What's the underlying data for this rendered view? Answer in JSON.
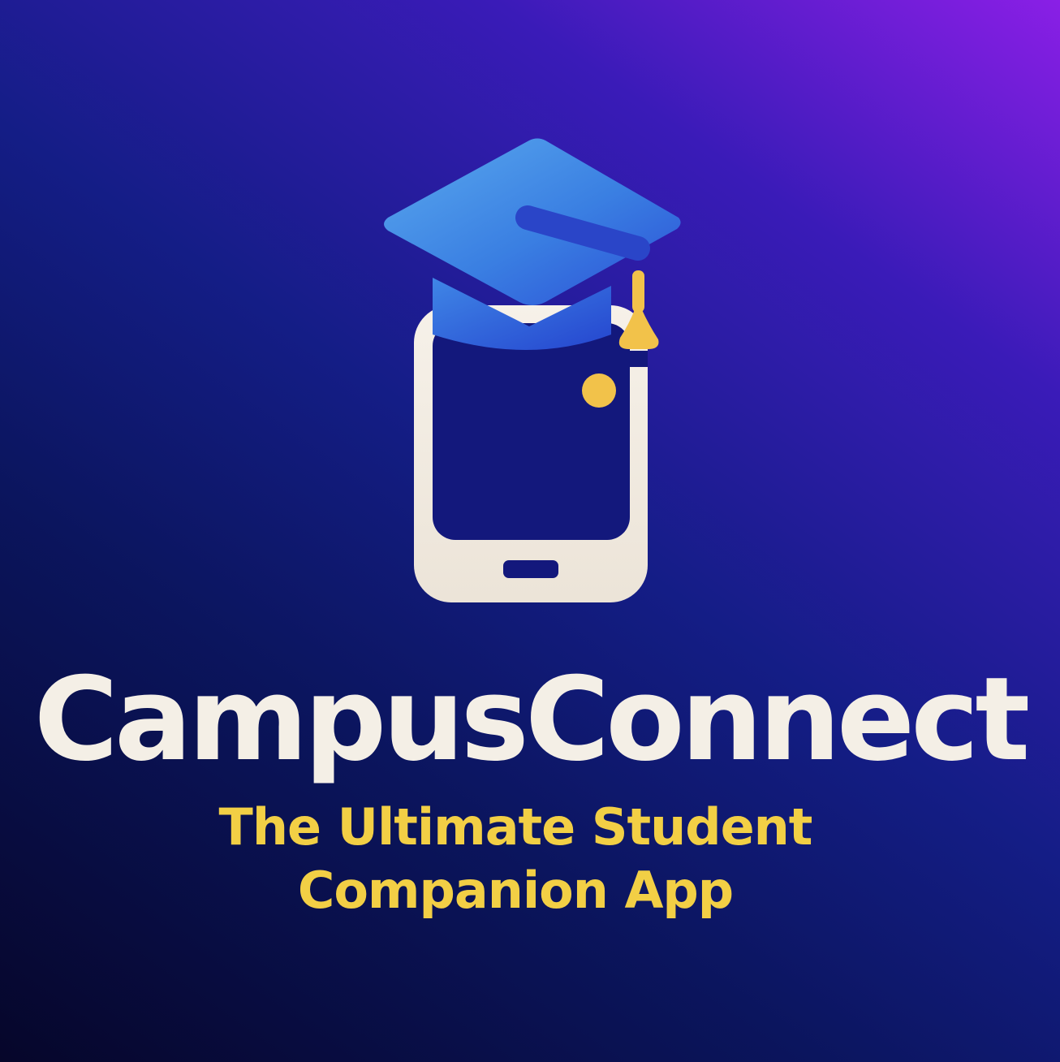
{
  "brand": {
    "name": "CampusConnect",
    "tagline_line1": "The Ultimate Student",
    "tagline_line2": "Companion App"
  },
  "logo": {
    "icons": [
      "phone-icon",
      "graduation-cap-icon",
      "tassel-icon"
    ]
  },
  "colors": {
    "background_dark": "#06062a",
    "background_mid": "#141d86",
    "background_light": "#8a1fe6",
    "cap_blue": "#3b7fe0",
    "phone_cream": "#f4efe6",
    "accent_yellow": "#f2cf45"
  }
}
